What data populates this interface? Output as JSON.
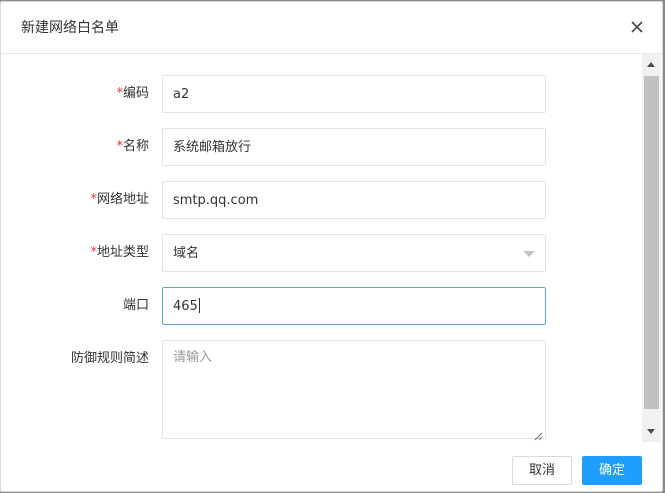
{
  "dialog": {
    "title": "新建网络白名单"
  },
  "form": {
    "code": {
      "label": "编码",
      "required_mark": "*",
      "value": "a2"
    },
    "name": {
      "label": "名称",
      "required_mark": "*",
      "value": "系统邮箱放行"
    },
    "address": {
      "label": "网络地址",
      "required_mark": "*",
      "value": "smtp.qq.com"
    },
    "address_type": {
      "label": "地址类型",
      "required_mark": "*",
      "value": "域名"
    },
    "port": {
      "label": "端口",
      "value": "465"
    },
    "description": {
      "label": "防御规则简述",
      "placeholder": "请输入",
      "value": ""
    }
  },
  "footer": {
    "cancel_label": "取消",
    "ok_label": "确定"
  },
  "colors": {
    "primary": "#1e9fff",
    "required": "#e23b3b",
    "focus_border": "#5fa8d8"
  },
  "icons": {
    "close": "close-icon",
    "select_arrow": "triangle-down-icon",
    "scroll_up": "triangle-up-icon",
    "scroll_down": "triangle-down-icon",
    "resize": "resize-grip-icon"
  }
}
